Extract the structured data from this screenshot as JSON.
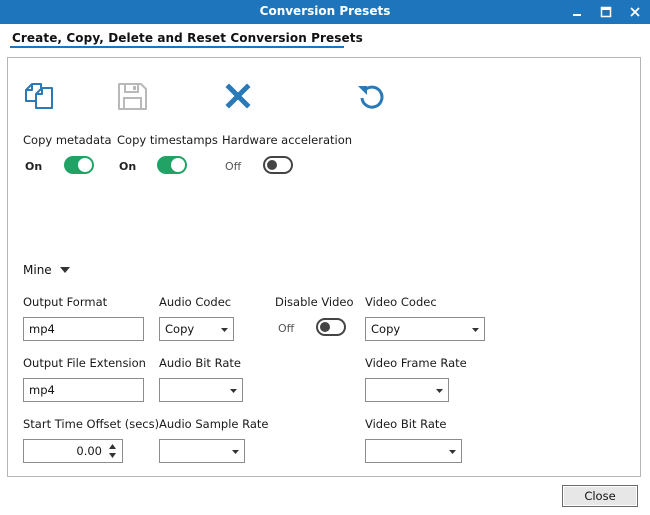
{
  "window": {
    "title": "Conversion Presets"
  },
  "section": {
    "title": "Create, Copy, Delete and Reset Conversion Presets"
  },
  "toolbar": {
    "copy_icon": "copy-icon",
    "save_icon": "save-icon",
    "delete_icon": "delete-icon",
    "reset_icon": "reset-icon"
  },
  "options": {
    "copy_metadata": {
      "label": "Copy metadata",
      "state": "On"
    },
    "copy_timestamps": {
      "label": "Copy timestamps",
      "state": "On"
    },
    "hardware_acceleration": {
      "label": "Hardware acceleration",
      "state": "Off"
    }
  },
  "preset": {
    "name": "Mine"
  },
  "form": {
    "output_format": {
      "label": "Output Format",
      "value": "mp4"
    },
    "output_extension": {
      "label": "Output File Extension",
      "value": "mp4"
    },
    "start_time_offset": {
      "label": "Start Time Offset (secs)",
      "value": "0.00"
    },
    "audio_codec": {
      "label": "Audio Codec",
      "value": "Copy"
    },
    "audio_bit_rate": {
      "label": "Audio Bit Rate",
      "value": ""
    },
    "audio_sample_rate": {
      "label": "Audio Sample Rate",
      "value": ""
    },
    "disable_video": {
      "label": "Disable Video",
      "state": "Off"
    },
    "video_codec": {
      "label": "Video Codec",
      "value": "Copy"
    },
    "video_frame_rate": {
      "label": "Video Frame Rate",
      "value": ""
    },
    "video_bit_rate": {
      "label": "Video Bit Rate",
      "value": ""
    }
  },
  "footer": {
    "close_label": "Close"
  },
  "colors": {
    "titlebar": "#1f75bb",
    "accent": "#1f75bb",
    "toggle_on": "#21a366",
    "icon_blue": "#2a7ab8"
  }
}
